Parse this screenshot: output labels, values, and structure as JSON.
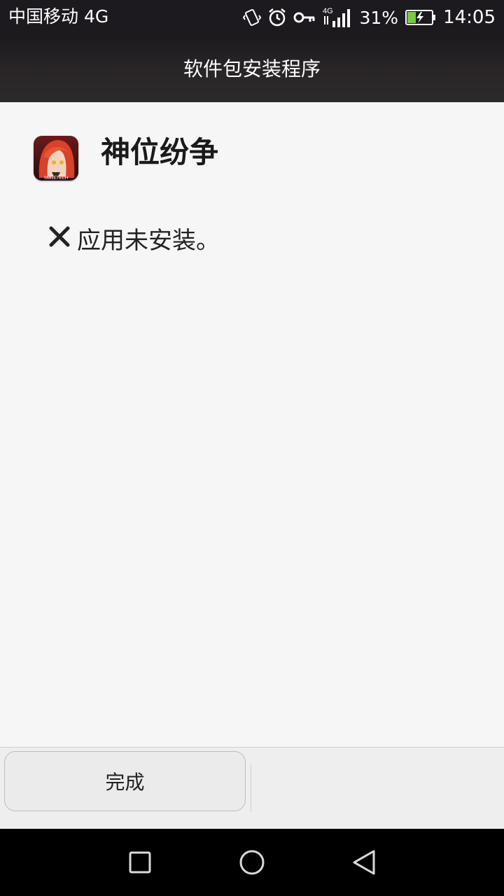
{
  "status_bar": {
    "carrier": "中国移动 4G",
    "network_type_label": "4G",
    "battery_percent": "31%",
    "time": "14:05",
    "icons": [
      "vibrate-icon",
      "alarm-icon",
      "vpn-key-icon",
      "signal-icon",
      "battery-charging-icon"
    ]
  },
  "title_bar": {
    "title": "软件包安装程序"
  },
  "app": {
    "name": "神位纷争",
    "icon": "app-icon",
    "icon_caption": "SMILETECH"
  },
  "result": {
    "icon": "close-icon",
    "message": "应用未安装。"
  },
  "actions": {
    "done_label": "完成"
  },
  "nav_bar": {
    "buttons": [
      "recent-apps-icon",
      "home-icon",
      "back-icon"
    ]
  },
  "colors": {
    "status_bar_bg": "#1c1a1e",
    "content_bg": "#f6f6f6",
    "nav_bg": "#000000",
    "battery_fill": "#7ac943"
  }
}
